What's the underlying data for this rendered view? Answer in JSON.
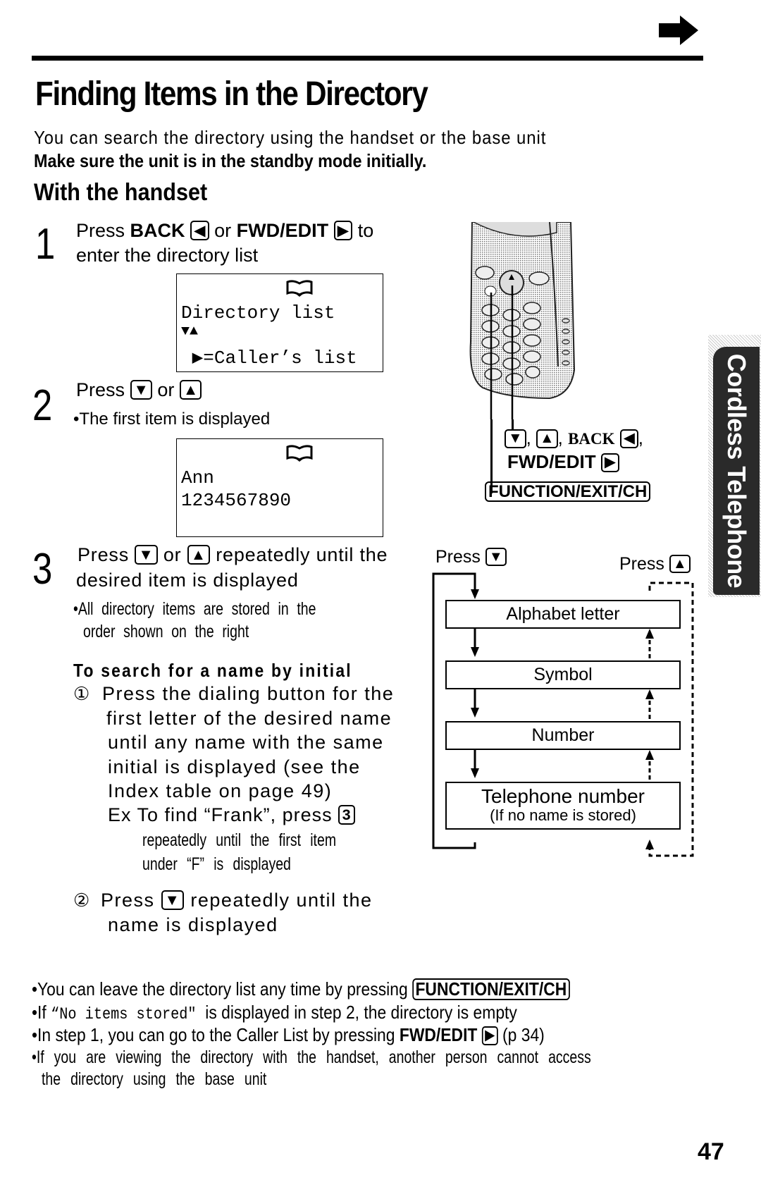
{
  "page": {
    "title": "Finding Items in the Directory",
    "intro": "You can search the directory using the handset or the base unit",
    "intro_bold": "Make sure the unit is in the standby mode initially.",
    "section_title": "With the handset",
    "page_number": "47",
    "side_tab": "Cordless Telephone"
  },
  "icons": {
    "next_page": "arrow-right-icon",
    "book": "book-icon"
  },
  "steps": [
    {
      "number": "1",
      "line1_a": "Press ",
      "line1_back": "BACK",
      "line1_back_key": "◀",
      "line1_b": " or ",
      "line1_fwd": "FWD/EDIT",
      "line1_fwd_key": "▶",
      "line1_c": " to",
      "line2": "enter the directory list",
      "display": {
        "line1": "Directory list",
        "line2": "▼▲",
        "line3": " ▶=Caller’s list"
      }
    },
    {
      "number": "2",
      "line1_a": "Press ",
      "key_down": "▼",
      "line1_b": " or ",
      "key_up": "▲",
      "bullet": "•The first item is displayed",
      "display": {
        "line1": "Ann",
        "line2": "1234567890"
      }
    },
    {
      "number": "3",
      "line1_a": "Press ",
      "key_down": "▼",
      "line1_b": " or ",
      "key_up": "▲",
      "line1_c": " repeatedly until the",
      "line2": "desired item is displayed",
      "bullet_line1": "•All directory items are stored in the",
      "bullet_line2": "order shown on the right",
      "subsection_title": "To search for a name by initial",
      "sub1_marker": "①",
      "sub1_lines": [
        "Press the dialing button for the",
        "first letter of the desired name",
        "until any name with the same",
        "initial is displayed (see the",
        "Index table on page 49)"
      ],
      "sub1_example": "Ex To find “Frank”, press ",
      "sub1_example_key": "3",
      "sub1_example_cont1": "repeatedly until the first item",
      "sub1_example_cont2": "under “F” is displayed",
      "sub2_marker": "②",
      "sub2_a": "Press ",
      "sub2_key": "▼",
      "sub2_b": " repeatedly until the",
      "sub2_line2": "name is displayed"
    }
  ],
  "handset_callout": {
    "key_down": "▼",
    "key_up": "▲",
    "back_label": "BACK",
    "back_key": "◀",
    "fwd_label": "FWD/EDIT",
    "fwd_key": "▶",
    "function_key": "FUNCTION/EXIT/CH"
  },
  "flow": {
    "press_down_label": "Press ",
    "press_down_key": "▼",
    "press_up_label": "Press ",
    "press_up_key": "▲",
    "boxes": [
      {
        "label": "Alphabet letter"
      },
      {
        "label": "Symbol"
      },
      {
        "label": "Number"
      },
      {
        "label": "Telephone number",
        "sublabel": "(If no name is stored)"
      }
    ]
  },
  "notes": [
    {
      "a": "•You can leave the directory list any time by pressing ",
      "key": "FUNCTION/EXIT/CH"
    },
    {
      "a": "•If ",
      "mono": "“No items stored\"",
      "b": "  is displayed in step 2, the directory is empty"
    },
    {
      "a": "•In step 1, you can go to the Caller List by pressing ",
      "bold": "FWD/EDIT",
      "key": "▶",
      "b": " (p 34)"
    },
    {
      "a": "•If you are viewing the directory with the handset, another person cannot access"
    },
    {
      "a": " the directory using the base unit"
    }
  ]
}
